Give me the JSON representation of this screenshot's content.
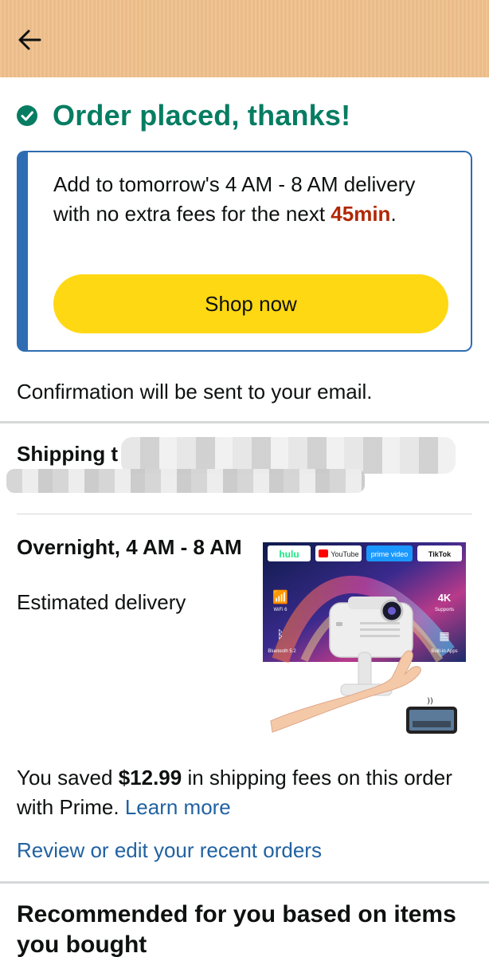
{
  "header": {
    "back_icon": "arrow-left-icon",
    "background_color": "#efc08c"
  },
  "order_status": {
    "icon": "check-circle-icon",
    "title": "Order placed, thanks!",
    "color": "#067d62"
  },
  "promo": {
    "text_before": "Add to tomorrow's 4 AM - 8 AM delivery with no extra fees for the next ",
    "highlight": "45min",
    "text_after": ".",
    "button_label": "Shop now",
    "accent_color": "#2f6db2",
    "button_color": "#ffd814",
    "highlight_color": "#b12704"
  },
  "confirmation": {
    "text": "Confirmation will be sent to your email."
  },
  "shipping": {
    "label": "Shipping t"
  },
  "delivery": {
    "title": "Overnight, 4 AM - 8 AM",
    "subtitle": "Estimated delivery",
    "product_image": {
      "brands": [
        "hulu",
        "YouTube",
        "prime video",
        "TikTok"
      ],
      "badge_4k": "4K",
      "badge_4k_sub": "Supports",
      "wifi_label": "WiFi 6",
      "bluetooth_label": "Bluetooth 5.2",
      "apps_label": "Built-in Apps"
    }
  },
  "savings": {
    "prefix": "You saved ",
    "amount": "$12.99",
    "suffix": " in shipping fees on this order with Prime. ",
    "learn_more": "Learn more"
  },
  "review_link": "Review or edit your recent orders",
  "recommended": {
    "title": "Recommended for you based on items you bought"
  }
}
